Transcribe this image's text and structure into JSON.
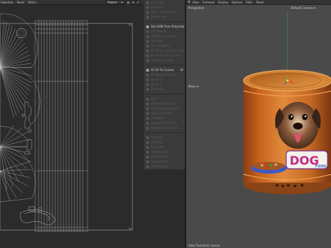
{
  "uv_editor": {
    "menu": [
      "Selection",
      "Panel",
      "Stitch..."
    ],
    "project_select": "Project",
    "corner_value": "1",
    "tick_left": "0"
  },
  "uv_tools": {
    "items": [
      {
        "label": "Fit Canvas",
        "active": false
      },
      {
        "label": "Relax UV",
        "active": false
      },
      {
        "label": "Mirror Horizontally",
        "active": false
      },
      {
        "label": "Stretch UV",
        "active": false
      },
      {
        "label": "Set UVW From Projection",
        "active": true,
        "gear": true
      },
      {
        "label": "UV Unwrap",
        "active": false
      },
      {
        "label": "UV Relax Preserve",
        "active": false
      },
      {
        "label": "UV Align",
        "active": false
      },
      {
        "label": "UV Straighten",
        "active": false
      },
      {
        "label": "Fit UV to Canvas Bounds",
        "active": false
      },
      {
        "label": "Fit UV Rect to Canvas",
        "active": false
      },
      {
        "label": "UV Island Count",
        "active": false
      },
      {
        "label": "Fit UV To Canvas",
        "active": true,
        "gear": true
      },
      {
        "label": "UV Islands to Grid",
        "active": false
      },
      {
        "label": "Mirror U",
        "active": false
      },
      {
        "label": "Mirror V",
        "active": false
      },
      {
        "label": "Fit UV To",
        "active": false
      },
      {
        "label": "Flip Y",
        "active": false
      },
      {
        "label": "UV Normalization",
        "active": false
      },
      {
        "label": "UV Re-Normalization",
        "active": false
      },
      {
        "label": "Align Horizontal",
        "active": false
      },
      {
        "label": "Straighten",
        "active": false
      },
      {
        "label": "Snapshot to Pixels",
        "active": false
      },
      {
        "label": "Resolution UV Scale",
        "active": false
      },
      {
        "label": "Pack UV",
        "active": false
      },
      {
        "label": "Scale UV",
        "active": false
      },
      {
        "label": "Scale UV",
        "active": false
      },
      {
        "label": "Transform UV",
        "active": false
      },
      {
        "label": "Scale UV XY",
        "active": false
      },
      {
        "label": "Scale UV XY",
        "active": false
      },
      {
        "label": "UV Manager",
        "active": false
      },
      {
        "label": "Move UV",
        "active": false
      },
      {
        "label": "Rotate UV",
        "active": false
      },
      {
        "label": "Bitmap",
        "active": false
      }
    ]
  },
  "viewport": {
    "menu": [
      "View",
      "Cameras",
      "Display",
      "Options",
      "Filter",
      "Panel"
    ],
    "perspective_label": "Perspective",
    "camera_label": "Default Camera ⟳",
    "move_label": "Move ⟳",
    "footer_label": "View Transform: Scene",
    "product_text": "DOG",
    "product_subtext": "FOOD"
  },
  "colors": {
    "can_orange": "#d97a2c",
    "can_dark": "#8a3e12",
    "accent_active": "#9aa0a8"
  }
}
